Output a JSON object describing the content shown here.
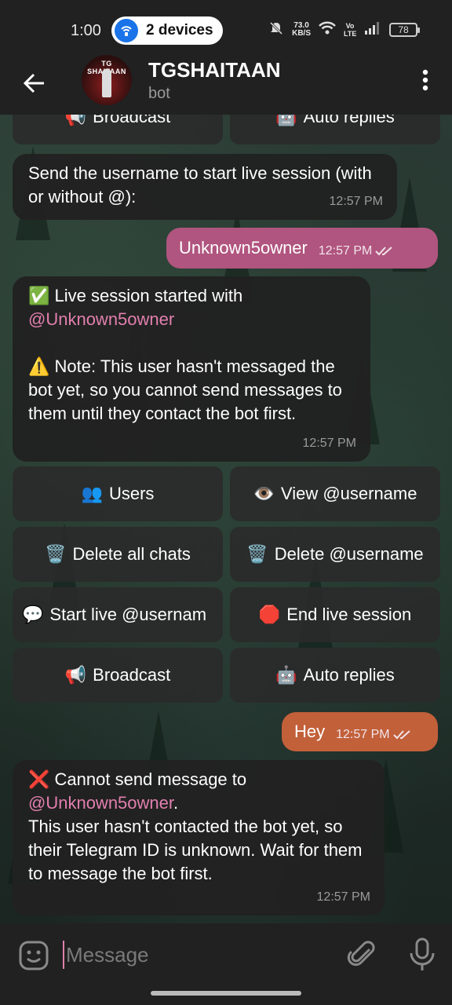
{
  "status_bar": {
    "time": "1:00",
    "devices_label": "2 devices",
    "net_speed_value": "73.0",
    "net_speed_unit": "KB/S",
    "lte": "Vo LTE",
    "battery": "78"
  },
  "header": {
    "title": "TGSHAITAAN",
    "subtitle": "bot",
    "avatar_text": "TG SHAITAAN"
  },
  "top_keyboard": {
    "broadcast": "Broadcast",
    "auto_replies": "Auto replies"
  },
  "messages": {
    "prompt": {
      "text": "Send the username to start live session (with or without @):",
      "time": "12:57 PM"
    },
    "sent_1": {
      "text": "Unknown5owner",
      "time": "12:57 PM"
    },
    "session": {
      "line1": "Live session started with",
      "mention": "@Unknown5owner",
      "note": "Note: This user hasn't messaged the bot yet, so you cannot send messages to them until they contact the bot first.",
      "time": "12:57 PM"
    },
    "sent_2": {
      "text": "Hey",
      "time": "12:57 PM"
    },
    "error": {
      "line1": "Cannot send message to",
      "mention": "@Unknown5owner",
      "rest": "This user hasn't contacted the bot yet, so their Telegram ID is unknown. Wait for them to message the bot first.",
      "time": "12:57 PM"
    }
  },
  "keyboard": {
    "users": "Users",
    "view_username": "View @username",
    "delete_all": "Delete all chats",
    "delete_username": "Delete @username",
    "start_live": "Start live @usernam",
    "end_live": "End live session",
    "broadcast": "Broadcast",
    "auto_replies": "Auto replies"
  },
  "input": {
    "placeholder": "Message"
  },
  "colors": {
    "outgoing_1": "#b0557f",
    "outgoing_2": "#c2603a",
    "link": "#e27fae"
  }
}
